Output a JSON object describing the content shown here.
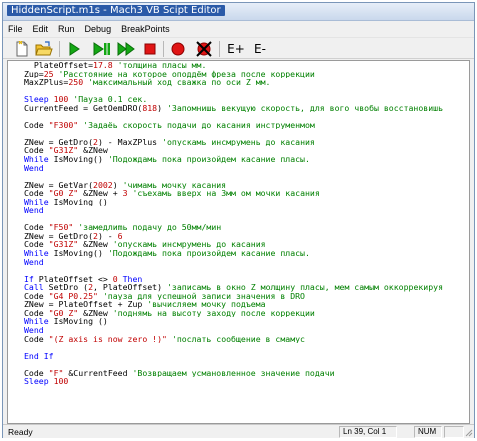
{
  "window": {
    "title": "HiddenScript.m1s - Mach3 VB Scipt Editor"
  },
  "menu": [
    "File",
    "Edit",
    "Run",
    "Debug",
    "BreakPoints"
  ],
  "toolbar": {
    "buttons": [
      "new-file",
      "open-folder",
      "run",
      "step",
      "step-over",
      "stop",
      "breakpoint",
      "clear-breakpoints",
      "watch-add",
      "watch-remove"
    ],
    "labels": {
      "watch_add": "E+",
      "watch_remove": "E-"
    },
    "colors": {
      "green": "#14a814",
      "red": "#e01414",
      "folder": "#f2c230"
    }
  },
  "code_lines": [
    [
      [
        "  PlateOffset=",
        ""
      ],
      [
        "17.8",
        "num"
      ],
      [
        " 'толщина пласы мм.",
        "cmt"
      ]
    ],
    [
      [
        "Zup=",
        ""
      ],
      [
        "25",
        "num"
      ],
      [
        " 'Расстояние на которое оподдём фреза после коррекции",
        "cmt"
      ]
    ],
    [
      [
        "MaxZPlus=",
        ""
      ],
      [
        "250",
        "num"
      ],
      [
        " 'максимальный ход сважка по оси Z мм.",
        "cmt"
      ]
    ],
    [
      [
        "",
        ""
      ]
    ],
    [
      [
        "Sleep ",
        "kw"
      ],
      [
        "100",
        "num"
      ],
      [
        " 'Пауза 0.1 сек.",
        "cmt"
      ]
    ],
    [
      [
        "CurrentFeed = GetOemDRO(",
        ""
      ],
      [
        "818",
        "num"
      ],
      [
        ") ",
        ""
      ],
      [
        "'Запомнишь векущую скорость, для вого чвобы восстановишь",
        "cmt"
      ]
    ],
    [
      [
        "",
        ""
      ]
    ],
    [
      [
        "Code ",
        ""
      ],
      [
        "\"F300\"",
        "str"
      ],
      [
        " 'Задаёь скорость подачи до касания инструменмом",
        "cmt"
      ]
    ],
    [
      [
        "",
        ""
      ]
    ],
    [
      [
        "ZNew = GetDro(",
        ""
      ],
      [
        "2",
        "num"
      ],
      [
        ") - MaxZPlus ",
        ""
      ],
      [
        "'опускамь инсмрумень до касания",
        "cmt"
      ]
    ],
    [
      [
        "Code ",
        ""
      ],
      [
        "\"G31Z\"",
        "str"
      ],
      [
        " &ZNew",
        ""
      ]
    ],
    [
      [
        "While ",
        "kw"
      ],
      [
        "IsMoving() ",
        ""
      ],
      [
        "'Подождамь пока произойдем касание пласы.",
        "cmt"
      ]
    ],
    [
      [
        "Wend",
        "kw"
      ]
    ],
    [
      [
        "",
        ""
      ]
    ],
    [
      [
        "ZNew = GetVar(",
        ""
      ],
      [
        "2002",
        "num"
      ],
      [
        ") ",
        ""
      ],
      [
        "'чимамь мочку касания",
        "cmt"
      ]
    ],
    [
      [
        "Code ",
        ""
      ],
      [
        "\"G0 Z\"",
        "str"
      ],
      [
        " &ZNew + ",
        ""
      ],
      [
        "3",
        "num"
      ],
      [
        " 'съехамь вверх на 3мм ом мочки касания",
        "cmt"
      ]
    ],
    [
      [
        "While ",
        "kw"
      ],
      [
        "IsMoving ()",
        ""
      ]
    ],
    [
      [
        "Wend",
        "kw"
      ]
    ],
    [
      [
        "",
        ""
      ]
    ],
    [
      [
        "Code ",
        ""
      ],
      [
        "\"F50\"",
        "str"
      ],
      [
        " 'замедлиmь подачу до 50мм/мин",
        "cmt"
      ]
    ],
    [
      [
        "ZNew = GetDro(",
        ""
      ],
      [
        "2",
        "num"
      ],
      [
        ") - ",
        ""
      ],
      [
        "6",
        "num"
      ]
    ],
    [
      [
        "Code ",
        ""
      ],
      [
        "\"G31Z\"",
        "str"
      ],
      [
        " &ZNew ",
        ""
      ],
      [
        "'опускамь инсмрумень до касания",
        "cmt"
      ]
    ],
    [
      [
        "While ",
        "kw"
      ],
      [
        "IsMoving() ",
        ""
      ],
      [
        "'Подождамь пока произойдем касание пласы.",
        "cmt"
      ]
    ],
    [
      [
        "Wend",
        "kw"
      ]
    ],
    [
      [
        "",
        ""
      ]
    ],
    [
      [
        "If ",
        "kw"
      ],
      [
        "PlateOffset <> ",
        ""
      ],
      [
        "0",
        "num"
      ],
      [
        " Then",
        "kw"
      ]
    ],
    [
      [
        "Call ",
        "kw"
      ],
      [
        "SetDro (",
        ""
      ],
      [
        "2",
        "num"
      ],
      [
        ", PlateOffset) ",
        ""
      ],
      [
        "'записамь в окно Z молщину пласы, мем самым оккоррекируя",
        "cmt"
      ]
    ],
    [
      [
        "Code ",
        ""
      ],
      [
        "\"G4 P0.25\"",
        "str"
      ],
      [
        " 'пауза для успешной записи значения в DRO",
        "cmt"
      ]
    ],
    [
      [
        "ZNew = PlateOffset + Zup ",
        ""
      ],
      [
        "'вычисляем мочку подъема",
        "cmt"
      ]
    ],
    [
      [
        "Code ",
        ""
      ],
      [
        "\"G0 Z\"",
        "str"
      ],
      [
        " &ZNew ",
        ""
      ],
      [
        "'поднямь на высоту заходу после коррекции",
        "cmt"
      ]
    ],
    [
      [
        "While ",
        "kw"
      ],
      [
        "IsMoving ()",
        ""
      ]
    ],
    [
      [
        "Wend",
        "kw"
      ]
    ],
    [
      [
        "Code ",
        ""
      ],
      [
        "\"(Z axis is now zero !)\"",
        "str"
      ],
      [
        " 'послать сообщение в смамус",
        "cmt"
      ]
    ],
    [
      [
        "",
        ""
      ]
    ],
    [
      [
        "End If",
        "kw"
      ]
    ],
    [
      [
        "",
        ""
      ]
    ],
    [
      [
        "Code ",
        ""
      ],
      [
        "\"F\"",
        "str"
      ],
      [
        " &CurrentFeed ",
        ""
      ],
      [
        "'Возвращаем усмановленное значение подачи",
        "cmt"
      ]
    ],
    [
      [
        "Sleep ",
        "kw"
      ],
      [
        "100",
        "num"
      ]
    ]
  ],
  "status": {
    "ready": "Ready",
    "position": "Ln 39, Col 1",
    "num": "NUM"
  }
}
